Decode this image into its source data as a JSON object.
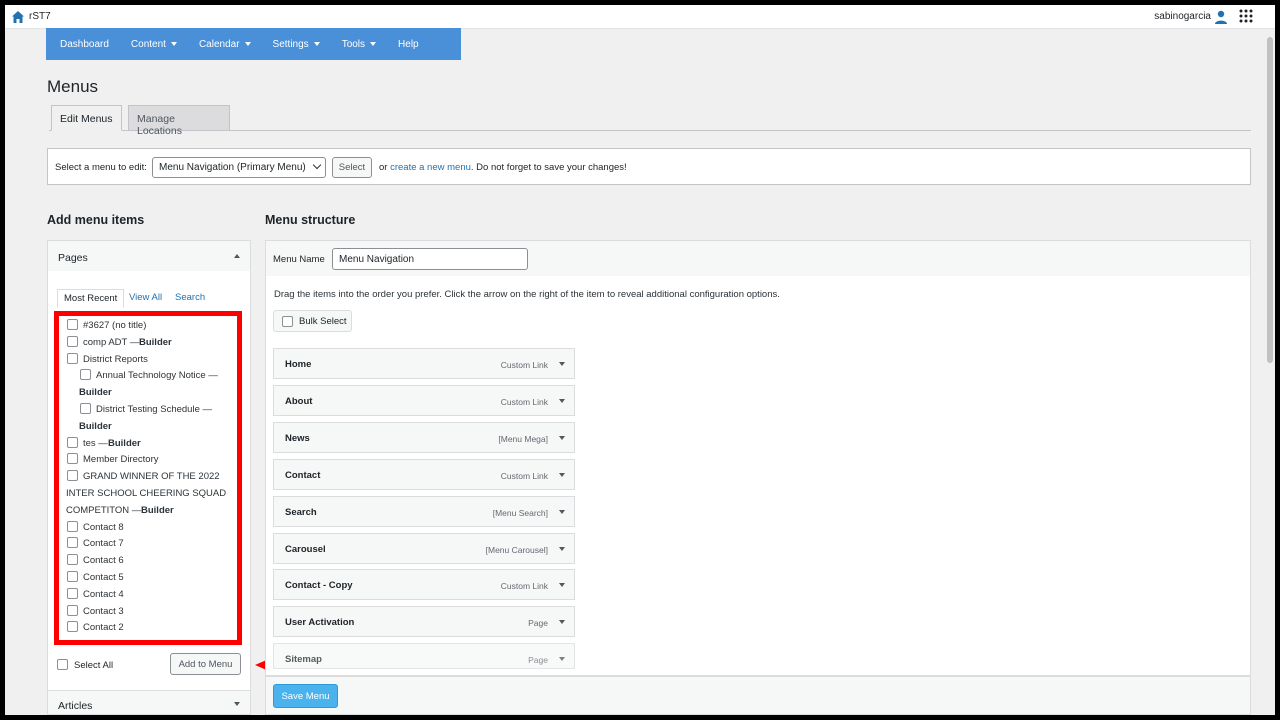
{
  "topbar": {
    "site_name": "rST7",
    "username": "sabinogarcia"
  },
  "nav": [
    "Dashboard",
    "Content",
    "Calendar",
    "Settings",
    "Tools",
    "Help"
  ],
  "page_title": "Menus",
  "tabs": {
    "edit": "Edit Menus",
    "manage": "Manage Locations"
  },
  "select_bar": {
    "label": "Select a menu to edit:",
    "selected_menu": "Menu Navigation (Primary Menu)",
    "select_button": "Select",
    "text_or": "or",
    "create_link": "create a new menu",
    "text_after": ". Do not forget to save your changes!"
  },
  "add_items": {
    "heading": "Add menu items",
    "pages_title": "Pages",
    "subtabs": [
      "Most Recent",
      "View All",
      "Search"
    ],
    "select_all": "Select All",
    "add_button": "Add to Menu",
    "articles_title": "Articles",
    "pages": [
      {
        "lines": [
          "#3627 (no title)"
        ]
      },
      {
        "lines": [
          "comp ADT — "
        ],
        "bold": "Builder"
      },
      {
        "lines": [
          "District Reports"
        ]
      },
      {
        "lines": [
          "Annual Technology Notice —"
        ],
        "bold2": "Builder"
      },
      {
        "lines": [
          "District Testing Schedule —"
        ],
        "bold2": "Builder"
      },
      {
        "lines": [
          "tes — "
        ],
        "bold": "Builder"
      },
      {
        "lines": [
          "Member Directory"
        ]
      },
      {
        "lines": [
          "GRAND WINNER OF THE 2022",
          "INTER SCHOOL CHEERING SQUAD",
          "COMPETITON — "
        ],
        "bold": "Builder"
      },
      {
        "lines": [
          "Contact 8"
        ]
      },
      {
        "lines": [
          "Contact 7"
        ]
      },
      {
        "lines": [
          "Contact 6"
        ]
      },
      {
        "lines": [
          "Contact 5"
        ]
      },
      {
        "lines": [
          "Contact 4"
        ]
      },
      {
        "lines": [
          "Contact 3"
        ]
      },
      {
        "lines": [
          "Contact 2"
        ]
      }
    ]
  },
  "structure": {
    "heading": "Menu structure",
    "name_label": "Menu Name",
    "name_value": "Menu Navigation",
    "hint": "Drag the items into the order you prefer. Click the arrow on the right of the item to reveal additional configuration options.",
    "bulk_select": "Bulk Select",
    "items": [
      {
        "name": "Home",
        "type": "Custom Link"
      },
      {
        "name": "About",
        "type": "Custom Link"
      },
      {
        "name": "News",
        "type": "[Menu Mega]"
      },
      {
        "name": "Contact",
        "type": "Custom Link"
      },
      {
        "name": "Search",
        "type": "[Menu Search]"
      },
      {
        "name": "Carousel",
        "type": "[Menu Carousel]"
      },
      {
        "name": "Contact - Copy",
        "type": "Custom Link"
      },
      {
        "name": "User Activation",
        "type": "Page"
      },
      {
        "name": "Sitemap",
        "type": "Page"
      }
    ],
    "save_button": "Save Menu"
  },
  "colors": {
    "nav_bg": "#4a90d9",
    "highlight": "#ff0000",
    "save_button": "#4ab3ed"
  }
}
